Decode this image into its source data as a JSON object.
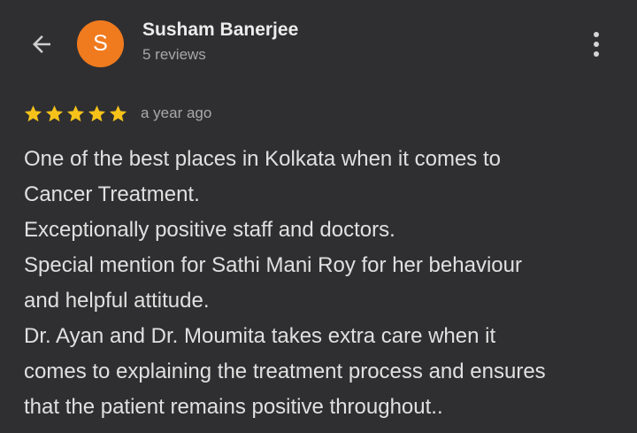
{
  "header": {
    "back_icon": "arrow-left-icon",
    "avatar_letter": "S",
    "avatar_color": "#f07b1f",
    "reviewer_name": "Susham Banerjee",
    "review_count": "5 reviews",
    "more_icon": "more-vert-icon"
  },
  "review": {
    "rating": 5,
    "rating_max": 5,
    "star_color": "#f6c21a",
    "time_ago": "a year ago",
    "lines": [
      "One of the best places in Kolkata when it comes to",
      "Cancer Treatment.",
      "Exceptionally positive staff and doctors.",
      "Special mention for Sathi Mani Roy for her behaviour",
      "and helpful attitude.",
      "Dr. Ayan and Dr. Moumita takes extra care when it",
      "comes to explaining the treatment process and ensures",
      "that the patient remains positive throughout.."
    ]
  }
}
